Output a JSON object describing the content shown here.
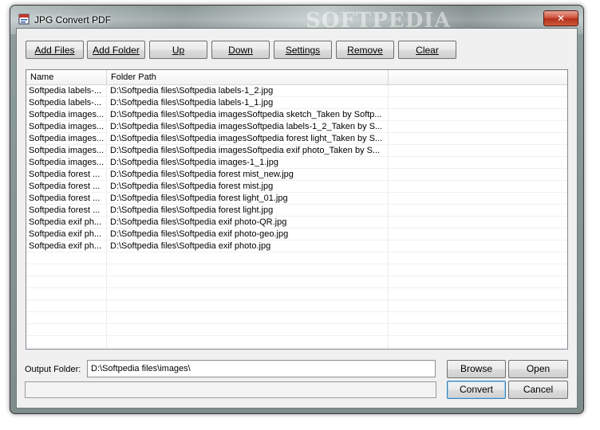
{
  "window": {
    "title": "JPG Convert PDF",
    "watermark": "SOFTPEDIA",
    "close_label": "✕"
  },
  "toolbar": {
    "buttons": [
      {
        "label": "Add Files"
      },
      {
        "label": "Add Folder"
      },
      {
        "label": "Up"
      },
      {
        "label": "Down"
      },
      {
        "label": "Settings"
      },
      {
        "label": "Remove"
      },
      {
        "label": "Clear"
      }
    ]
  },
  "list": {
    "columns": [
      "Name",
      "Folder Path",
      ""
    ],
    "rows": [
      {
        "name": "Softpedia labels-...",
        "path": "D:\\Softpedia files\\Softpedia labels-1_2.jpg"
      },
      {
        "name": "Softpedia labels-...",
        "path": "D:\\Softpedia files\\Softpedia labels-1_1.jpg"
      },
      {
        "name": "Softpedia images...",
        "path": "D:\\Softpedia files\\Softpedia imagesSoftpedia sketch_Taken by Softp..."
      },
      {
        "name": "Softpedia images...",
        "path": "D:\\Softpedia files\\Softpedia imagesSoftpedia labels-1_2_Taken by S..."
      },
      {
        "name": "Softpedia images...",
        "path": "D:\\Softpedia files\\Softpedia imagesSoftpedia forest light_Taken by S..."
      },
      {
        "name": "Softpedia images...",
        "path": "D:\\Softpedia files\\Softpedia imagesSoftpedia exif photo_Taken by S..."
      },
      {
        "name": "Softpedia images...",
        "path": "D:\\Softpedia files\\Softpedia images-1_1.jpg"
      },
      {
        "name": "Softpedia forest ...",
        "path": "D:\\Softpedia files\\Softpedia forest mist_new.jpg"
      },
      {
        "name": "Softpedia forest ...",
        "path": "D:\\Softpedia files\\Softpedia forest mist.jpg"
      },
      {
        "name": "Softpedia forest ...",
        "path": "D:\\Softpedia files\\Softpedia forest light_01.jpg"
      },
      {
        "name": "Softpedia forest ...",
        "path": "D:\\Softpedia files\\Softpedia forest light.jpg"
      },
      {
        "name": "Softpedia exif ph...",
        "path": "D:\\Softpedia files\\Softpedia exif photo-QR.jpg"
      },
      {
        "name": "Softpedia exif ph...",
        "path": "D:\\Softpedia files\\Softpedia exif photo-geo.jpg"
      },
      {
        "name": "Softpedia exif ph...",
        "path": "D:\\Softpedia files\\Softpedia exif photo.jpg"
      }
    ]
  },
  "output": {
    "label": "Output Folder:",
    "value": "D:\\Softpedia files\\images\\"
  },
  "actions": {
    "browse": "Browse",
    "open": "Open",
    "convert": "Convert",
    "cancel": "Cancel"
  }
}
